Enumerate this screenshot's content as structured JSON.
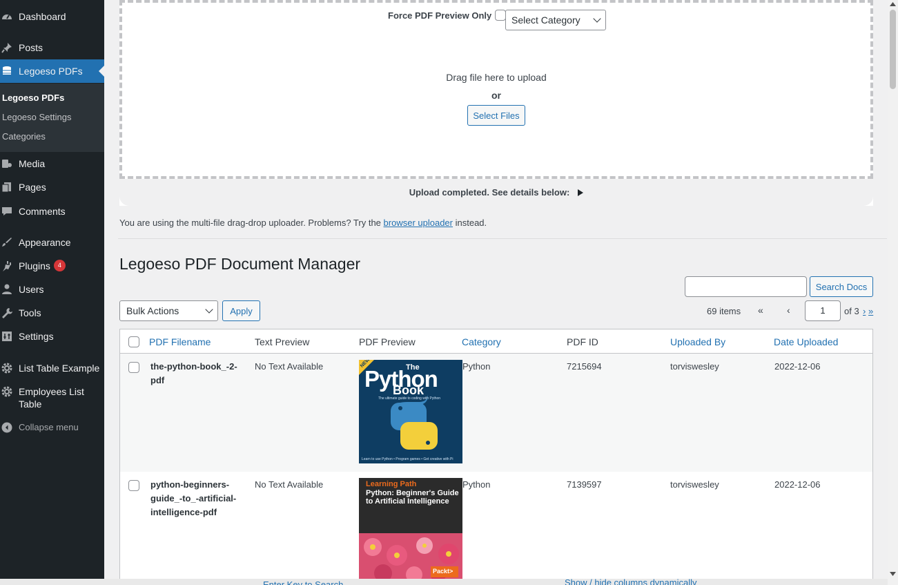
{
  "sidebar": {
    "items": [
      {
        "label": "Dashboard",
        "icon": "dashboard-icon"
      },
      {
        "label": "Posts",
        "icon": "pin-icon"
      },
      {
        "label": "Legoeso PDFs",
        "icon": "database-icon"
      },
      {
        "label": "Media",
        "icon": "media-icon"
      },
      {
        "label": "Pages",
        "icon": "pages-icon"
      },
      {
        "label": "Comments",
        "icon": "comment-icon"
      },
      {
        "label": "Appearance",
        "icon": "brush-icon"
      },
      {
        "label": "Plugins",
        "icon": "plugin-icon",
        "badge": "4"
      },
      {
        "label": "Users",
        "icon": "user-icon"
      },
      {
        "label": "Tools",
        "icon": "wrench-icon"
      },
      {
        "label": "Settings",
        "icon": "settings-icon"
      },
      {
        "label": "List Table Example",
        "icon": "gear-icon"
      },
      {
        "label": "Employees List Table",
        "icon": "gear-icon"
      }
    ],
    "submenu": [
      "Legoeso PDFs",
      "Legoeso Settings",
      "Categories"
    ],
    "collapse": "Collapse menu"
  },
  "uploader": {
    "force_label": "Force PDF Preview Only",
    "category_select": "Select Category",
    "drag_text": "Drag file here to upload",
    "or_text": "or",
    "select_files": "Select Files",
    "status": "Upload completed. See details below:"
  },
  "hint": {
    "prefix": "You are using the multi-file drag-drop uploader. Problems? Try the",
    "link": "browser uploader",
    "suffix": "instead."
  },
  "page_title": "Legoeso PDF Document Manager",
  "search_button": "Search Docs",
  "bulk": {
    "select": "Bulk Actions",
    "apply": "Apply"
  },
  "pagination": {
    "items": "69 items",
    "first": "«",
    "prev": "‹",
    "current": "1",
    "of": "of 3",
    "next": "›",
    "last": "»"
  },
  "table": {
    "columns": [
      "PDF Filename",
      "Text Preview",
      "PDF Preview",
      "Category",
      "PDF ID",
      "Uploaded By",
      "Date Uploaded"
    ],
    "rows": [
      {
        "filename": "the-python-book_-2-pdf",
        "text": "No Text Available",
        "category": "Python",
        "id": "7215694",
        "by": "torviswesley",
        "date": "2022-12-06"
      },
      {
        "filename": "python-beginners-guide_-to_-artificial-intelligence-pdf",
        "text": "No Text Available",
        "category": "Python",
        "id": "7139597",
        "by": "torviswesley",
        "date": "2022-12-06"
      }
    ]
  },
  "covers": {
    "book1": {
      "tag": "NEW",
      "the": "The",
      "title": "Python",
      "sub": "Book",
      "tagline": "The ultimate guide to coding with Python",
      "bottom": "Learn to use Python • Program games • Get creative with Pi"
    },
    "book2": {
      "path": "Learning Path",
      "title": "Python: Beginner's Guide to Artificial Intelligence",
      "publisher": "Packt>"
    }
  },
  "ghost": {
    "left": "Enter Key to Search",
    "right": "Show / hide columns dynamically"
  },
  "colors": {
    "sidebar": "#1d2327",
    "active": "#2271b1",
    "badge": "#d63638"
  }
}
